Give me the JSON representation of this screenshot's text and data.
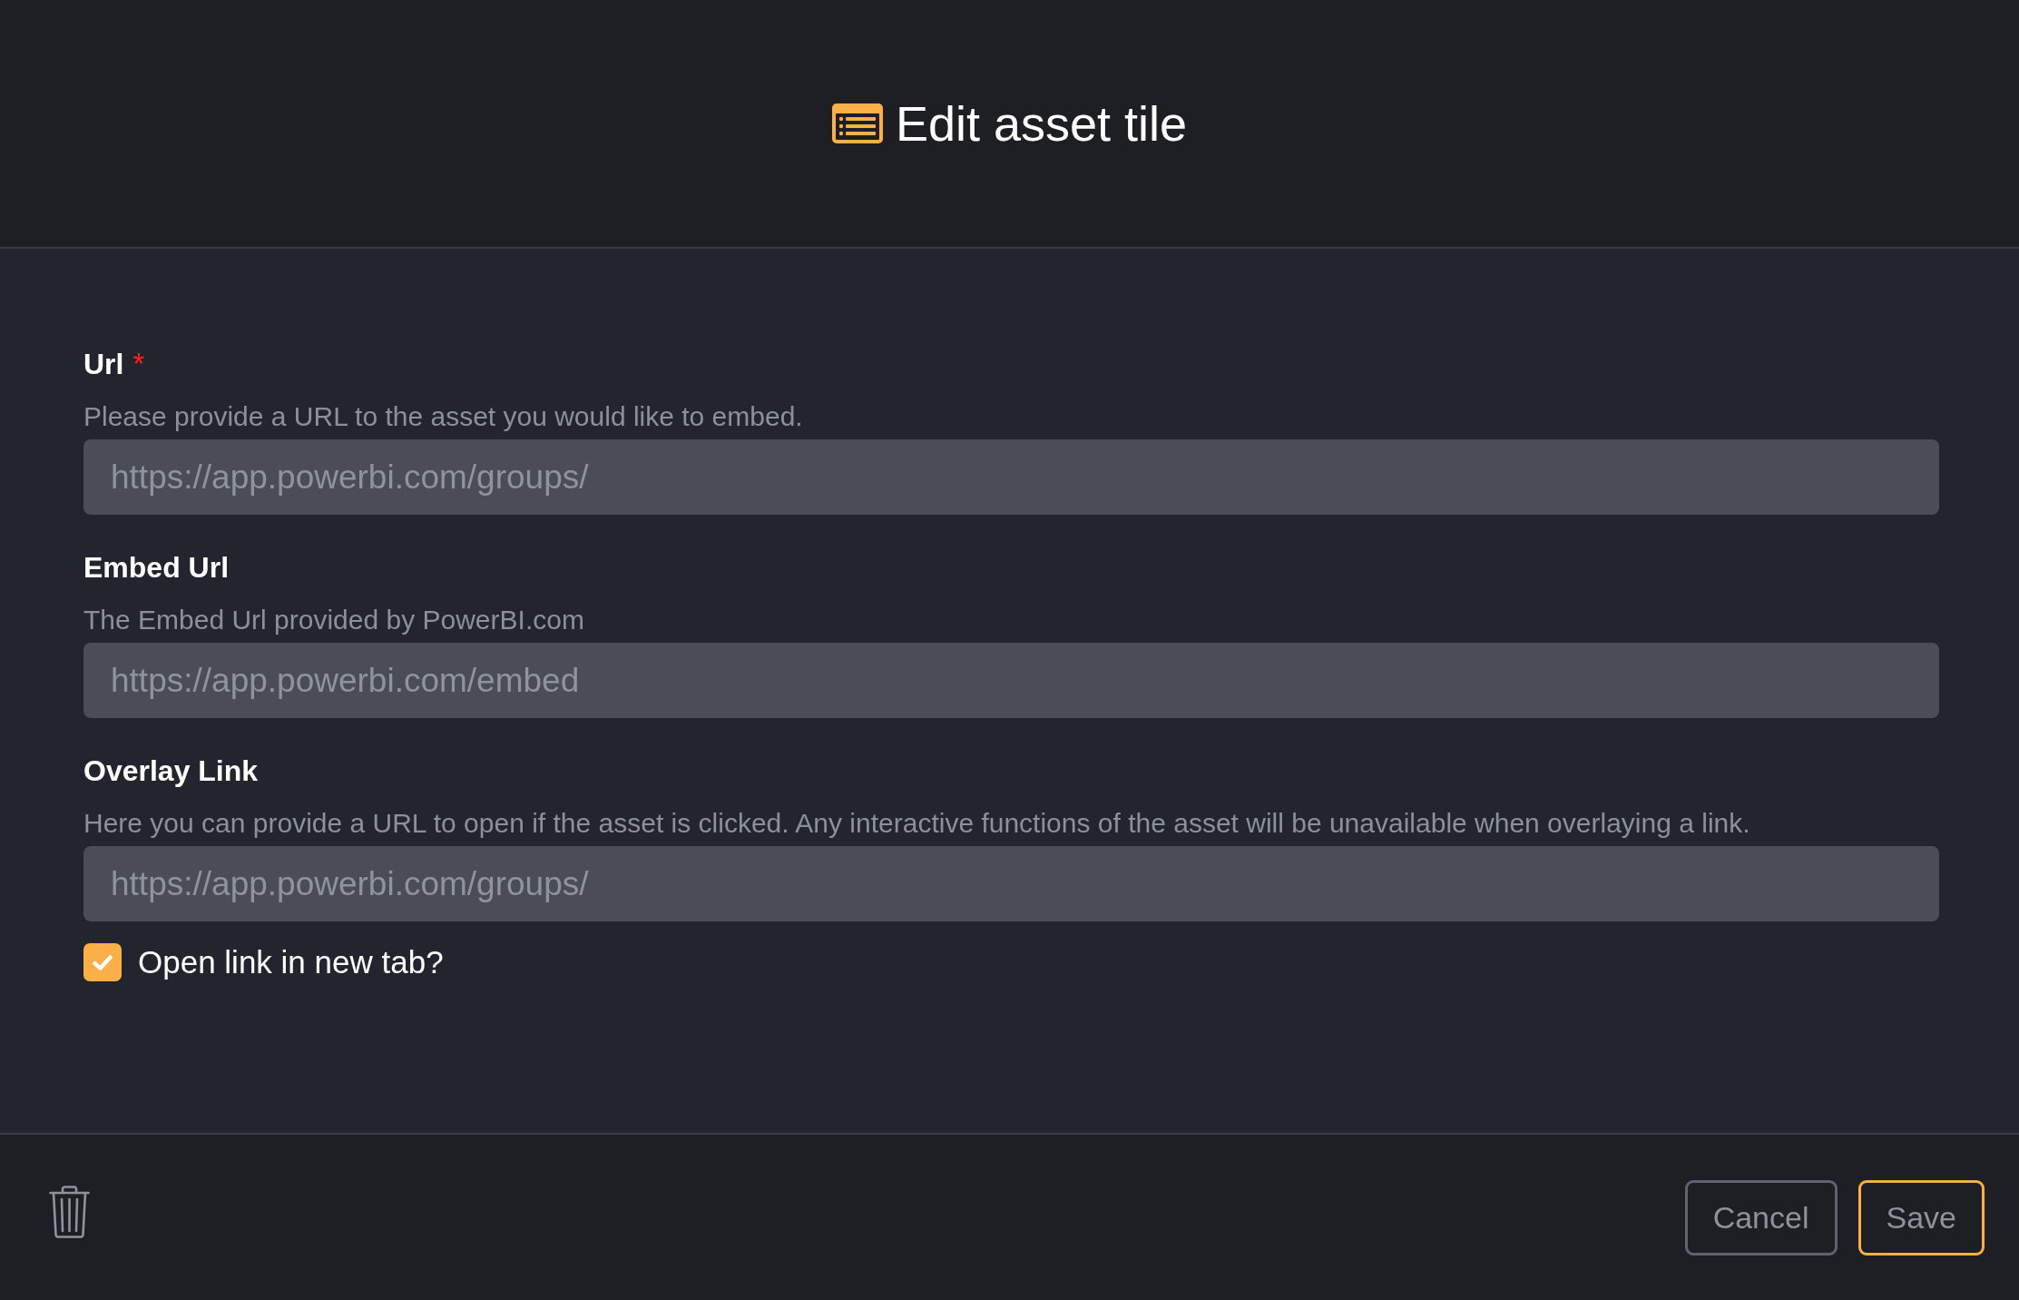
{
  "dialog": {
    "title": "Edit asset tile",
    "fields": [
      {
        "label": "Url",
        "required_mark": "*",
        "description": "Please provide a URL to the asset you would like to embed.",
        "value": "https://app.powerbi.com/groups/"
      },
      {
        "label": "Embed Url",
        "description": "The Embed Url provided by PowerBI.com",
        "value": "https://app.powerbi.com/embed"
      },
      {
        "label": "Overlay Link",
        "description": "Here you can provide a URL to open if the asset is clicked. Any interactive functions of the asset will be unavailable when overlaying a link.",
        "value": "https://app.powerbi.com/groups/"
      }
    ],
    "open_in_new_tab": {
      "label": "Open link in new tab?",
      "checked": true
    },
    "buttons": [
      {
        "label": "Cancel",
        "kind": "secondary"
      },
      {
        "label": "Save",
        "kind": "primary"
      }
    ]
  }
}
